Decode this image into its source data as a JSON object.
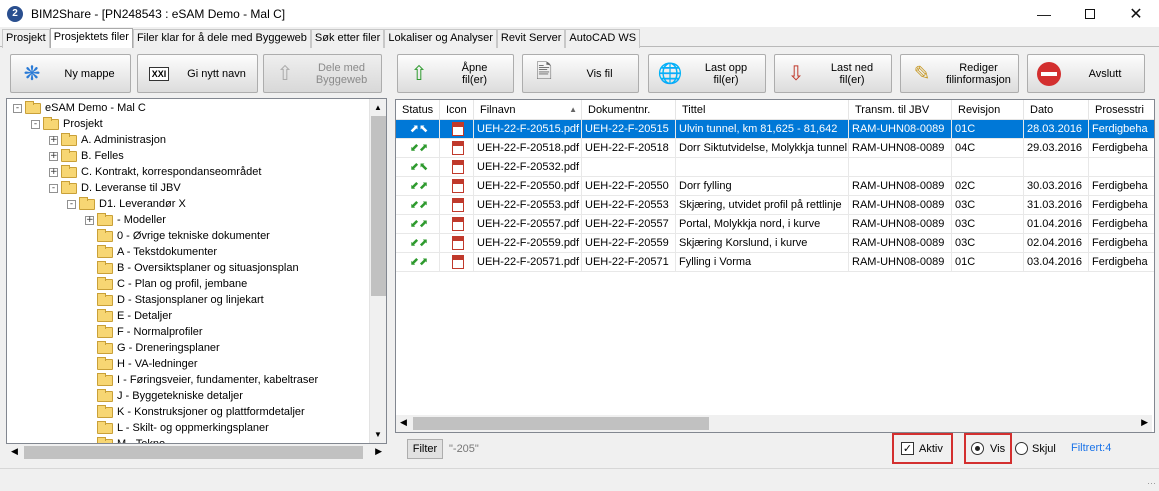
{
  "window": {
    "title": "BIM2Share - [PN248543 : eSAM Demo - Mal C]",
    "logo_letter": "2"
  },
  "tabs": [
    "Prosjekt",
    "Prosjektets filer",
    "Filer klar for å dele med Byggeweb",
    "Søk etter filer",
    "Lokaliser og Analyser",
    "Revit Server",
    "AutoCAD WS"
  ],
  "left_toolbar": {
    "new_folder": "Ny mappe",
    "rename": "Gi nytt navn",
    "share_line1": "Dele med",
    "share_line2": "Byggeweb",
    "rename_icon_text": "XXI"
  },
  "right_toolbar": {
    "open_l1": "Åpne",
    "open_l2": "fil(er)",
    "view": "Vis fil",
    "upload_l1": "Last opp",
    "upload_l2": "fil(er)",
    "download_l1": "Last ned",
    "download_l2": "fil(er)",
    "edit_l1": "Rediger",
    "edit_l2": "filinformasjon",
    "exit": "Avslutt"
  },
  "tree": [
    {
      "label": "eSAM Demo - Mal C",
      "level": 0,
      "exp": "-"
    },
    {
      "label": "Prosjekt",
      "level": 1,
      "exp": "-"
    },
    {
      "label": "A. Administrasjon",
      "level": 2,
      "exp": "+"
    },
    {
      "label": "B. Felles",
      "level": 2,
      "exp": "+"
    },
    {
      "label": "C. Kontrakt, korrespondanseområdet",
      "level": 2,
      "exp": "+"
    },
    {
      "label": "D. Leveranse til JBV",
      "level": 2,
      "exp": "-"
    },
    {
      "label": "D1. Leverandør X",
      "level": 3,
      "exp": "-"
    },
    {
      "label": "- Modeller",
      "level": 4,
      "exp": "+"
    },
    {
      "label": "0 - Øvrige tekniske dokumenter",
      "level": 4,
      "exp": ""
    },
    {
      "label": "A - Tekstdokumenter",
      "level": 4,
      "exp": ""
    },
    {
      "label": "B - Oversiktsplaner og situasjonsplan",
      "level": 4,
      "exp": ""
    },
    {
      "label": "C - Plan og profil, jembane",
      "level": 4,
      "exp": ""
    },
    {
      "label": "D - Stasjonsplaner og linjekart",
      "level": 4,
      "exp": ""
    },
    {
      "label": "E - Detaljer",
      "level": 4,
      "exp": ""
    },
    {
      "label": "F - Normalprofiler",
      "level": 4,
      "exp": ""
    },
    {
      "label": "G - Dreneringsplaner",
      "level": 4,
      "exp": ""
    },
    {
      "label": "H - VA-ledninger",
      "level": 4,
      "exp": ""
    },
    {
      "label": "I - Føringsveier, fundamenter, kabeltraser",
      "level": 4,
      "exp": ""
    },
    {
      "label": "J - Byggetekniske detaljer",
      "level": 4,
      "exp": ""
    },
    {
      "label": "K - Konstruksjoner og plattformdetaljer",
      "level": 4,
      "exp": ""
    },
    {
      "label": "L - Skilt- og oppmerkingsplaner",
      "level": 4,
      "exp": ""
    },
    {
      "label": "M - Tekno...",
      "level": 4,
      "exp": ""
    }
  ],
  "grid": {
    "columns": [
      "Status",
      "Icon",
      "Filnavn",
      "Dokumentnr.",
      "Tittel",
      "Transm. til JBV",
      "Revisjon",
      "Dato",
      "Prosesstri"
    ],
    "rows": [
      {
        "status": "⬈⬉",
        "file": "UEH-22-F-20515.pdf",
        "doc": "UEH-22-F-20515",
        "title": "Ulvin tunnel, km 81,625 - 81,642",
        "transm": "RAM-UHN08-0089",
        "rev": "01C",
        "date": "28.03.2016",
        "proc": "Ferdigbeha"
      },
      {
        "status": "⬋⬈",
        "file": "UEH-22-F-20518.pdf",
        "doc": "UEH-22-F-20518",
        "title": "Dorr Siktutvidelse, Molykkja tunnel",
        "transm": "RAM-UHN08-0089",
        "rev": "04C",
        "date": "29.03.2016",
        "proc": "Ferdigbeha"
      },
      {
        "status": "⬋⬉",
        "file": "UEH-22-F-20532.pdf",
        "doc": "",
        "title": "",
        "transm": "",
        "rev": "",
        "date": "",
        "proc": ""
      },
      {
        "status": "⬋⬈",
        "file": "UEH-22-F-20550.pdf",
        "doc": "UEH-22-F-20550",
        "title": "Dorr fylling",
        "transm": "RAM-UHN08-0089",
        "rev": "02C",
        "date": "30.03.2016",
        "proc": "Ferdigbeha"
      },
      {
        "status": "⬋⬈",
        "file": "UEH-22-F-20553.pdf",
        "doc": "UEH-22-F-20553",
        "title": "Skjæring, utvidet profil på rettlinje",
        "transm": "RAM-UHN08-0089",
        "rev": "03C",
        "date": "31.03.2016",
        "proc": "Ferdigbeha"
      },
      {
        "status": "⬋⬈",
        "file": "UEH-22-F-20557.pdf",
        "doc": "UEH-22-F-20557",
        "title": "Portal, Molykkja nord, i kurve",
        "transm": "RAM-UHN08-0089",
        "rev": "03C",
        "date": "01.04.2016",
        "proc": "Ferdigbeha"
      },
      {
        "status": "⬋⬈",
        "file": "UEH-22-F-20559.pdf",
        "doc": "UEH-22-F-20559",
        "title": "Skjæring Korslund, i kurve",
        "transm": "RAM-UHN08-0089",
        "rev": "03C",
        "date": "02.04.2016",
        "proc": "Ferdigbeha"
      },
      {
        "status": "⬋⬈",
        "file": "UEH-22-F-20571.pdf",
        "doc": "UEH-22-F-20571",
        "title": "Fylling i Vorma",
        "transm": "RAM-UHN08-0089",
        "rev": "01C",
        "date": "03.04.2016",
        "proc": "Ferdigbeha"
      }
    ]
  },
  "filter": {
    "button": "Filter",
    "value": "\"-205\"",
    "aktiv": "Aktiv",
    "vis": "Vis",
    "skjul": "Skjul",
    "filtrert": "Filtrert:4"
  },
  "colors": {
    "selection": "#0078d7",
    "highlight": "#d32f2f",
    "filtered_text": "#1a73e8"
  }
}
